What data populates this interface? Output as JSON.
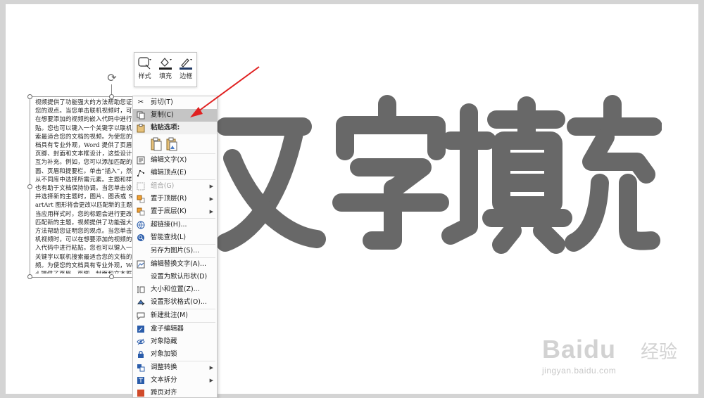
{
  "big_text": "文字填充",
  "textbox_paragraph": "视频提供了功能强大的方法帮助您证明您的观点。当您单击联机视频时，可以在想要添加的视频的嵌入代码中进行粘贴。您也可以键入一个关键字以联机搜索最适合您的文档的视频。为使您的文档具有专业外观，Word 提供了页眉、页脚、封面和文本框设计，这些设计可互为补充。例如，您可以添加匹配的封面、页眉和提要栏。单击“插入”，然后从不同库中选择所需元素。主题和样式也有助于文档保持协调。当您单击设计并选择新的主题时，图片、图表或 SmartArt 图形将会更改以匹配新的主题。当应用样式时，您的标题会进行更改以匹配新的主题。视频提供了功能强大的方法帮助您证明您的观点。当您单击联机视频时，可以在想要添加的视频的嵌入代码中进行粘贴。您也可以键入一个关键字以联机搜索最适合您的文档的视频。为使您的文档具有专业外观，Word 提供了页眉、页脚、封面和文本框设计，这些设计可互为补充。例如，您可以添加匹配的封面、页眉和提要栏。单击“插入”，然后从不同库中选择所需元素。主题和样式也有助于文档保持协调。当您单击设计并选择新的主题时，图片、图表或 SmartArt 图形将会更改以匹配新的主题。当应用样式时，您的标题会进行更改以匹配新的主题。",
  "mini_toolbar": {
    "style": "样式",
    "fill": "填充",
    "border": "边框"
  },
  "menu": {
    "cut": "剪切(T)",
    "copy": "复制(C)",
    "paste_options": "粘贴选项:",
    "edit_text": "编辑文字(X)",
    "edit_points": "编辑顶点(E)",
    "group": "组合(G)",
    "bring_to_front": "置于顶层(R)",
    "send_to_back": "置于底层(K)",
    "hyperlink": "超链接(H)...",
    "smart_lookup": "智能查找(L)",
    "save_as_picture": "另存为图片(S)...",
    "edit_alt_text": "编辑替换文字(A)...",
    "set_default_shape": "设置为默认形状(D)",
    "size_position": "大小和位置(Z)...",
    "format_shape": "设置形状格式(O)...",
    "new_comment": "新建批注(M)",
    "box_editor": "盒子编辑器",
    "hide_object": "对象隐藏",
    "lock_object": "对象加锁",
    "adjust_convert": "调整转换",
    "split_text": "文本拆分",
    "page_align": "跨页对齐"
  },
  "watermark": {
    "brand": "Baidu",
    "cn": "经验",
    "url": "jingyan.baidu.com"
  },
  "colors": {
    "big_text": "#686868",
    "menu_highlight": "#c5c5c5",
    "arrow": "#e02020",
    "fill_swatch": "#1f1f1f",
    "border_swatch": "#1f3864"
  }
}
